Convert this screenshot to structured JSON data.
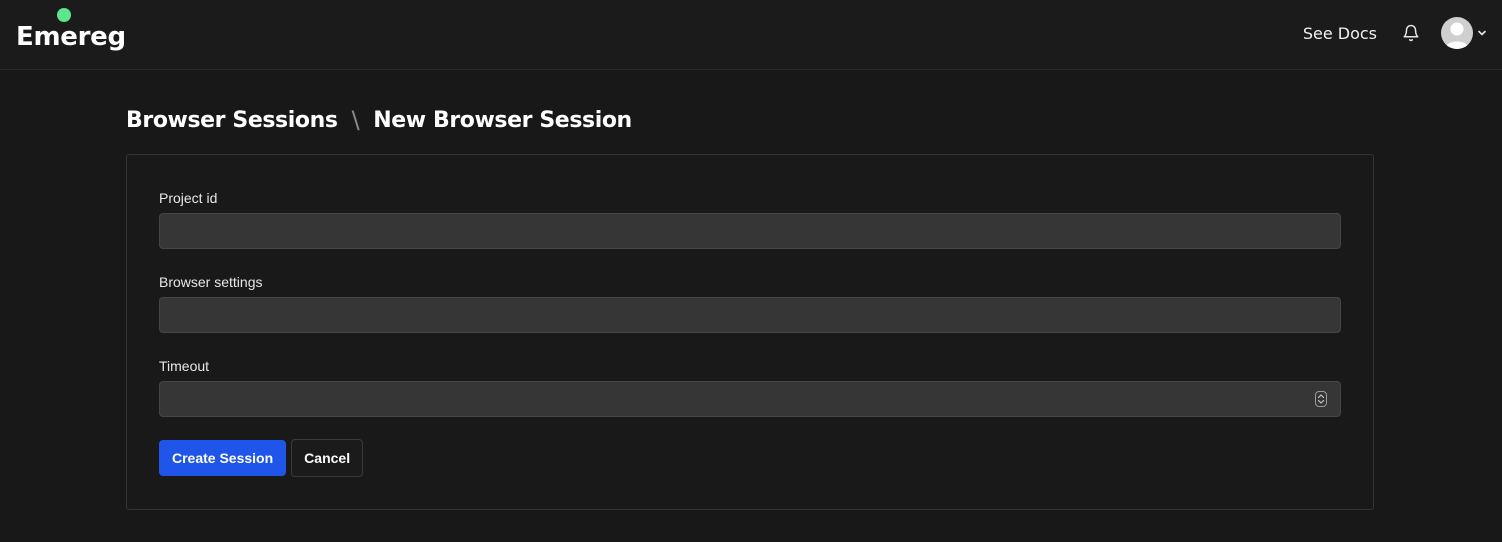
{
  "header": {
    "logo_text": "Emereg",
    "logo_dot_color": "#5ee68a",
    "docs_label": "See Docs",
    "bell_icon": "bell-icon",
    "avatar_icon": "user-avatar-icon",
    "chevron_icon": "chevron-down-icon"
  },
  "breadcrumb": {
    "parent": "Browser Sessions",
    "separator": "\\",
    "current": "New Browser Session"
  },
  "form": {
    "project_id": {
      "label": "Project id",
      "value": "",
      "placeholder": ""
    },
    "browser_settings": {
      "label": "Browser settings",
      "value": "",
      "placeholder": ""
    },
    "timeout": {
      "label": "Timeout",
      "value": "",
      "placeholder": ""
    },
    "submit_label": "Create Session",
    "cancel_label": "Cancel"
  },
  "colors": {
    "background": "#181818",
    "accent": "#1f55e8",
    "input_bg": "#363636"
  }
}
